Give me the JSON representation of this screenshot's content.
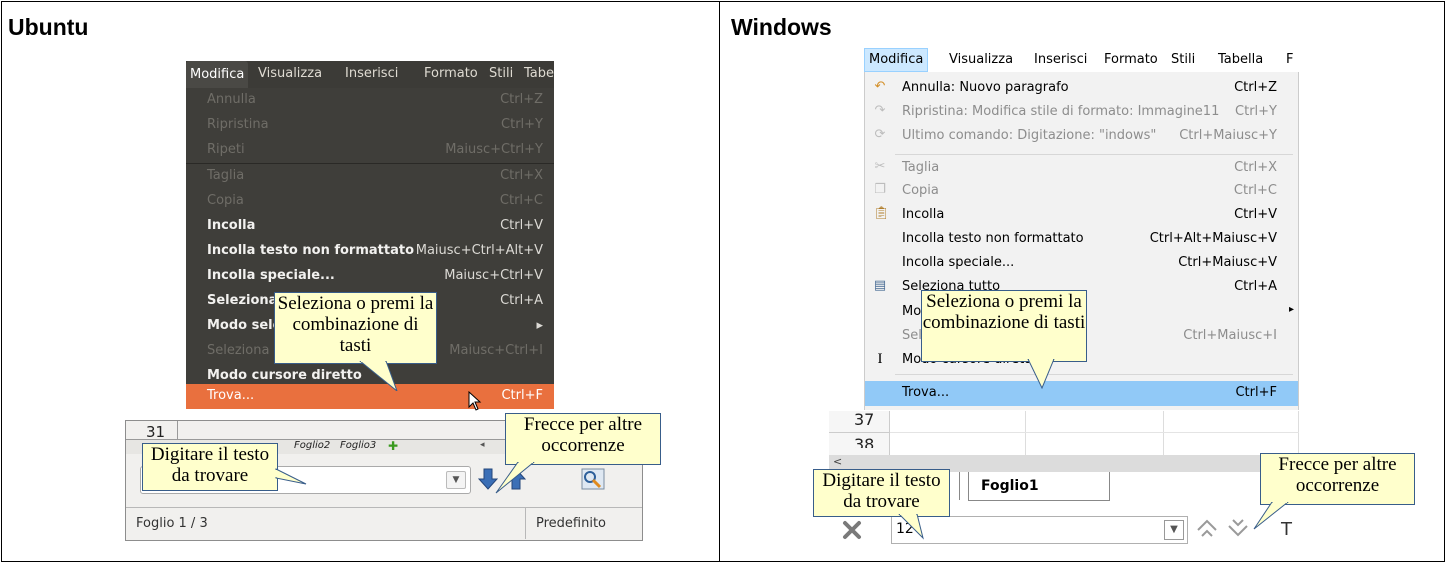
{
  "ubuntu": {
    "title": "Ubuntu",
    "menubar": [
      "Modifica",
      "Visualizza",
      "Inserisci",
      "Formato",
      "Stili",
      "Tabe"
    ],
    "menu_items": [
      {
        "label": "Annulla",
        "shortcut": "Ctrl+Z",
        "enabled": false
      },
      {
        "label": "Ripristina",
        "shortcut": "Ctrl+Y",
        "enabled": false
      },
      {
        "label": "Ripeti",
        "shortcut": "Maiusc+Ctrl+Y",
        "enabled": false
      },
      {
        "label": "Taglia",
        "shortcut": "Ctrl+X",
        "enabled": false
      },
      {
        "label": "Copia",
        "shortcut": "Ctrl+C",
        "enabled": false
      },
      {
        "label": "Incolla",
        "shortcut": "Ctrl+V",
        "enabled": true
      },
      {
        "label": "Incolla testo non formattato",
        "shortcut": "Maiusc+Ctrl+Alt+V",
        "enabled": true
      },
      {
        "label": "Incolla speciale...",
        "shortcut": "Maiusc+Ctrl+V",
        "enabled": true
      },
      {
        "label": "Seleziona tutto",
        "shortcut": "Ctrl+A",
        "enabled": true
      },
      {
        "label": "Modo selezione",
        "shortcut": "▸",
        "enabled": true
      },
      {
        "label": "Seleziona",
        "shortcut": "Maiusc+Ctrl+I",
        "enabled": false
      },
      {
        "label": "Modo cursore diretto",
        "shortcut": "",
        "enabled": true
      },
      {
        "label": "Trova...",
        "shortcut": "Ctrl+F",
        "enabled": true,
        "highlighted": true
      }
    ],
    "row_number": "31",
    "sheet_tabs": [
      "Foglio2",
      "Foglio3"
    ],
    "status_left": "Foglio 1 / 3",
    "status_right": "Predefinito"
  },
  "windows": {
    "title": "Windows",
    "menubar": [
      "Modifica",
      "Visualizza",
      "Inserisci",
      "Formato",
      "Stili",
      "Tabella",
      "F"
    ],
    "menu_items": [
      {
        "icon": "undo-icon",
        "label": "Annulla: Nuovo paragrafo",
        "shortcut": "Ctrl+Z",
        "enabled": true
      },
      {
        "icon": "redo-icon",
        "label": "Ripristina: Modifica stile di formato: Immagine11",
        "shortcut": "Ctrl+Y",
        "enabled": false
      },
      {
        "icon": "repeat-icon",
        "label": "Ultimo comando: Digitazione: \"indows\"",
        "shortcut": "Ctrl+Maiusc+Y",
        "enabled": false
      },
      {
        "icon": "scissors-icon",
        "label": "Taglia",
        "shortcut": "Ctrl+X",
        "enabled": false
      },
      {
        "icon": "copy-icon",
        "label": "Copia",
        "shortcut": "Ctrl+C",
        "enabled": false
      },
      {
        "icon": "clipboard-icon",
        "label": "Incolla",
        "shortcut": "Ctrl+V",
        "enabled": true
      },
      {
        "icon": "",
        "label": "Incolla testo non formattato",
        "shortcut": "Ctrl+Alt+Maiusc+V",
        "enabled": true
      },
      {
        "icon": "",
        "label": "Incolla speciale...",
        "shortcut": "Ctrl+Maiusc+V",
        "enabled": true
      },
      {
        "icon": "select-all-icon",
        "label": "Seleziona tutto",
        "shortcut": "Ctrl+A",
        "enabled": true
      },
      {
        "icon": "",
        "label": "Modo selezione",
        "shortcut": "▸",
        "enabled": true
      },
      {
        "icon": "",
        "label": "Seleziona",
        "shortcut": "Ctrl+Maiusc+I",
        "enabled": false
      },
      {
        "icon": "text-cursor-icon",
        "label": "Modo cursore diretto",
        "shortcut": "",
        "enabled": true
      },
      {
        "icon": "",
        "label": "Trova...",
        "shortcut": "Ctrl+F",
        "enabled": true,
        "highlighted": true
      }
    ],
    "row_numbers": [
      "37",
      "38"
    ],
    "sheet_tab": "Foglio1",
    "search_value": "12",
    "trailing_label": "T"
  },
  "callouts": {
    "shortcut": "Seleziona o premi la combinazione di tasti",
    "find_text": "Digitare il testo da trovare",
    "arrows": "Frecce per altre occorrenze"
  },
  "colors": {
    "ubuntu_menu_bg": "#3f3e3a",
    "ubuntu_highlight": "#e9703e",
    "windows_highlight": "#91c9f7",
    "callout_fill": "#ffffcc",
    "callout_border": "#385d8a"
  }
}
